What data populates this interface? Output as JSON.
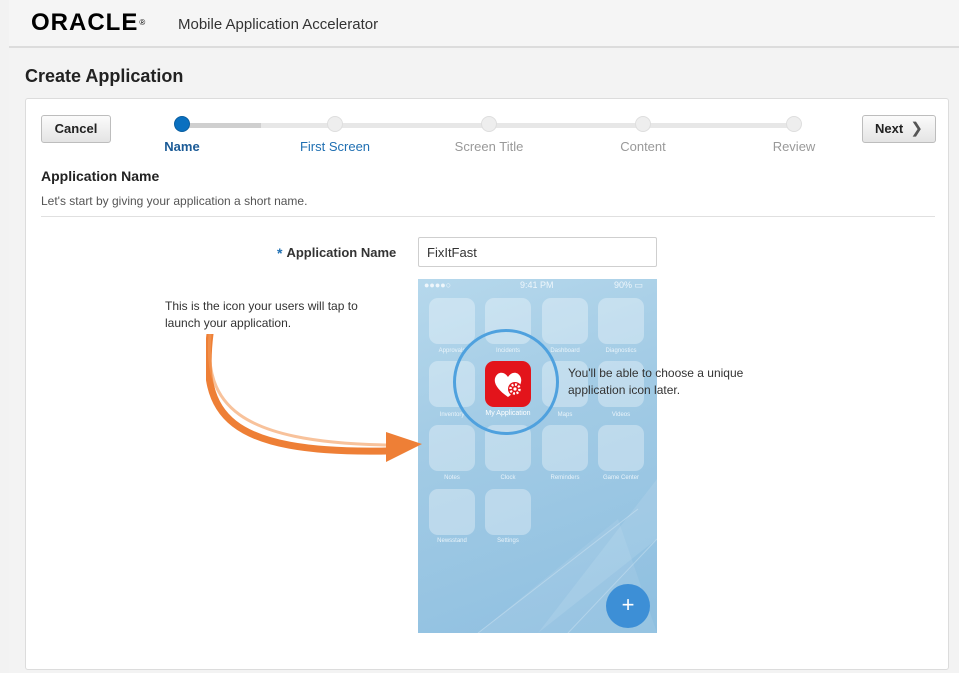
{
  "header": {
    "brand": "ORACLE",
    "brand_mark": "®",
    "app_title": "Mobile Application Accelerator"
  },
  "page": {
    "title": "Create Application"
  },
  "wizard": {
    "cancel_label": "Cancel",
    "next_label": "Next",
    "next_icon": "chevron-right-icon",
    "steps": [
      {
        "label": "Name",
        "state": "active"
      },
      {
        "label": "First Screen",
        "state": "link"
      },
      {
        "label": "Screen Title",
        "state": "disabled"
      },
      {
        "label": "Content",
        "state": "disabled"
      },
      {
        "label": "Review",
        "state": "disabled"
      }
    ]
  },
  "section": {
    "title": "Application Name",
    "subtitle": "Let's start by giving your application a short name."
  },
  "form": {
    "required_marker": "*",
    "app_name_label": "Application Name",
    "app_name_value": "FixItFast"
  },
  "phone_preview": {
    "time": "9:41 PM",
    "battery": "90%",
    "apps": [
      "Approvals",
      "Incidents",
      "Dashboard",
      "Diagnostics",
      "Inventory",
      "My Application",
      "Maps",
      "Videos",
      "Notes",
      "Clock",
      "Reminders",
      "Game Center",
      "Newsstand",
      "Settings"
    ],
    "highlighted_app": "My Application",
    "fab_label": "+"
  },
  "callouts": {
    "left": "This is the icon your users will tap to launch your application.",
    "right": "You'll be able to choose a unique application icon later."
  },
  "colors": {
    "accent": "#0a70c0",
    "arrow": "#ee7f36",
    "app_icon": "#e3141b",
    "spotlight": "#4fa1de"
  }
}
